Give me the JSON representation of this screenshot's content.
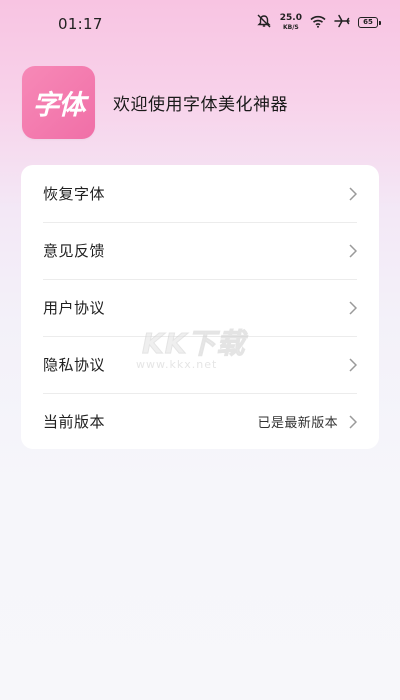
{
  "status_bar": {
    "time": "01:17",
    "speed_value": "25.0",
    "speed_unit": "KB/S",
    "battery": "65",
    "icons": [
      "mute-icon",
      "wifi-icon",
      "airplane-icon",
      "battery-icon"
    ]
  },
  "header": {
    "logo_text": "字体",
    "welcome": "欢迎使用字体美化神器"
  },
  "menu": {
    "items": [
      {
        "label": "恢复字体",
        "value": ""
      },
      {
        "label": "意见反馈",
        "value": ""
      },
      {
        "label": "用户协议",
        "value": ""
      },
      {
        "label": "隐私协议",
        "value": ""
      },
      {
        "label": "当前版本",
        "value": "已是最新版本"
      }
    ]
  },
  "watermark": {
    "text": "KK下载",
    "url": "www.kkx.net"
  },
  "colors": {
    "logo": "#f06fa7",
    "chevron": "#9a9a9a",
    "gradient_top": "#f8c4e2"
  }
}
